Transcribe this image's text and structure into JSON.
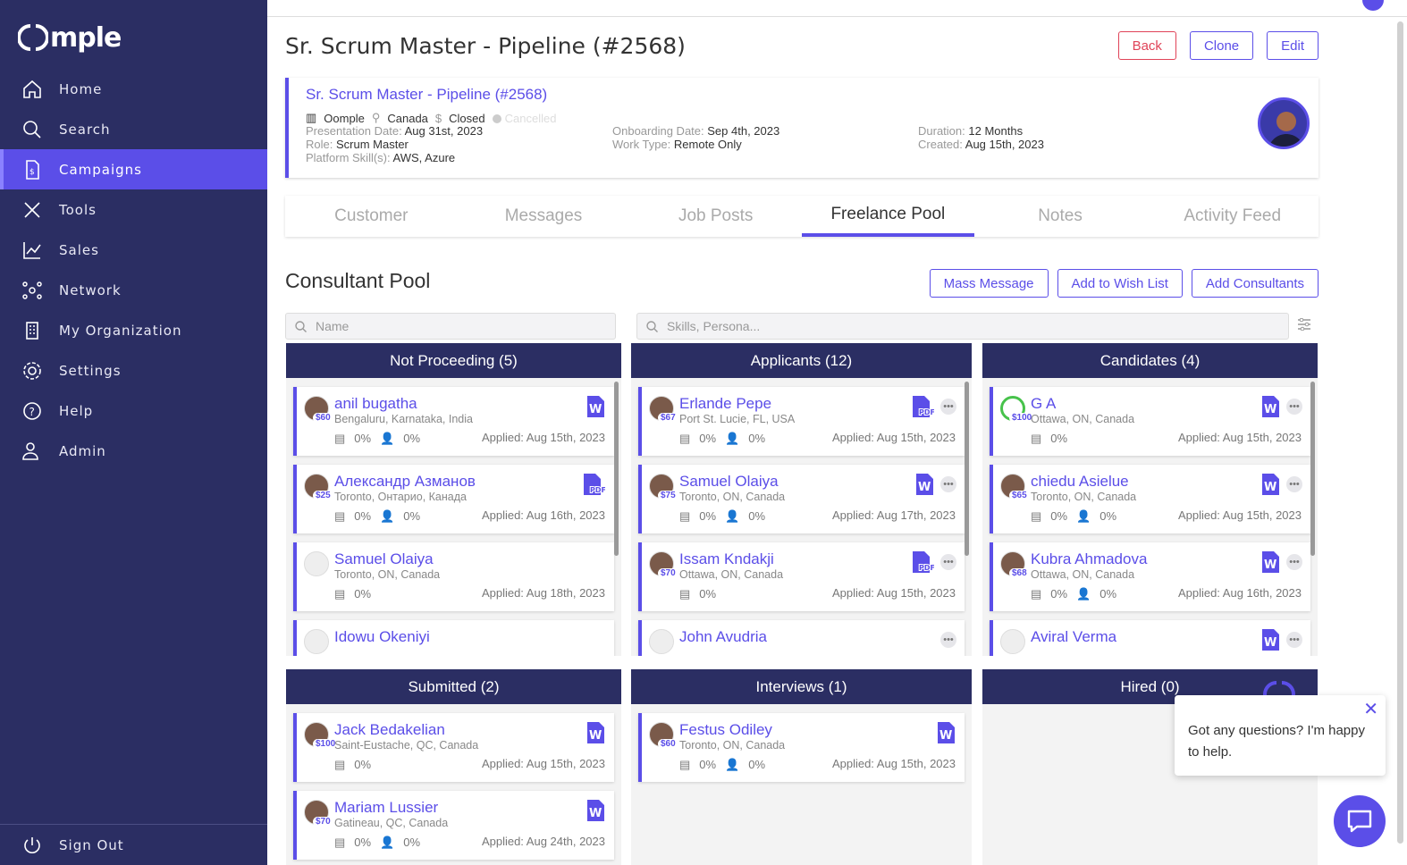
{
  "brand": {
    "logo": "mple"
  },
  "nav": {
    "items": [
      {
        "label": "Home",
        "icon": "home-icon"
      },
      {
        "label": "Search",
        "icon": "search-icon"
      },
      {
        "label": "Campaigns",
        "icon": "campaigns-icon"
      },
      {
        "label": "Tools",
        "icon": "tools-icon"
      },
      {
        "label": "Sales",
        "icon": "chart-icon"
      },
      {
        "label": "Network",
        "icon": "network-icon"
      },
      {
        "label": "My Organization",
        "icon": "building-icon"
      },
      {
        "label": "Settings",
        "icon": "gear-icon"
      },
      {
        "label": "Help",
        "icon": "help-icon"
      },
      {
        "label": "Admin",
        "icon": "admin-icon"
      }
    ],
    "signout": "Sign Out"
  },
  "header": {
    "title": "Sr. Scrum Master - Pipeline (#2568)",
    "back": "Back",
    "clone": "Clone",
    "edit": "Edit"
  },
  "campaign": {
    "title": "Sr. Scrum Master - Pipeline (#2568)",
    "company": "Oomple",
    "country": "Canada",
    "status": "Closed",
    "cancelled": "Cancelled",
    "presentation_k": "Presentation Date:",
    "presentation_v": "Aug 31st, 2023",
    "role_k": "Role:",
    "role_v": "Scrum Master",
    "skills_k": "Platform Skill(s):",
    "skills_v": "AWS, Azure",
    "onboarding_k": "Onboarding Date:",
    "onboarding_v": "Sep 4th, 2023",
    "worktype_k": "Work Type:",
    "worktype_v": "Remote Only",
    "duration_k": "Duration:",
    "duration_v": "12 Months",
    "created_k": "Created:",
    "created_v": "Aug 15th, 2023"
  },
  "tabs": [
    "Customer",
    "Messages",
    "Job Posts",
    "Freelance Pool",
    "Notes",
    "Activity Feed"
  ],
  "pool": {
    "title": "Consultant Pool",
    "mass_message": "Mass Message",
    "wish_list": "Add to Wish List",
    "add_consultants": "Add Consultants",
    "name_placeholder": "Name",
    "skills_placeholder": "Skills, Persona..."
  },
  "columns": [
    {
      "title": "Not Proceeding (5)",
      "cards": [
        {
          "name": "anil bugatha",
          "rate": "$60",
          "loc": "Bengaluru, Karnataka, India",
          "s1": "0%",
          "s2": "0%",
          "applied": "Applied: Aug 15th, 2023",
          "doc": "word"
        },
        {
          "name": "Александр Азманов",
          "rate": "$25",
          "loc": "Toronto, Онтарио, Канада",
          "s1": "0%",
          "s2": "0%",
          "applied": "Applied: Aug 16th, 2023",
          "doc": "pdf"
        },
        {
          "name": "Samuel Olaiya",
          "rate": "",
          "loc": "Toronto, ON, Canada",
          "s1": "0%",
          "s2": "",
          "applied": "Applied: Aug 18th, 2023",
          "doc": ""
        },
        {
          "name": "Idowu Okeniyi",
          "rate": "",
          "loc": "",
          "s1": "",
          "s2": "",
          "applied": "",
          "doc": ""
        }
      ]
    },
    {
      "title": "Applicants (12)",
      "cards": [
        {
          "name": "Erlande Pepe",
          "rate": "$67",
          "loc": "Port St. Lucie, FL, USA",
          "s1": "0%",
          "s2": "0%",
          "applied": "Applied: Aug 15th, 2023",
          "doc": "pdf"
        },
        {
          "name": "Samuel Olaiya",
          "rate": "$75",
          "loc": "Toronto, ON, Canada",
          "s1": "0%",
          "s2": "0%",
          "applied": "Applied: Aug 17th, 2023",
          "doc": "word"
        },
        {
          "name": "Issam Kndakji",
          "rate": "$70",
          "loc": "Ottawa, ON, Canada",
          "s1": "0%",
          "s2": "",
          "applied": "Applied: Aug 15th, 2023",
          "doc": "pdf"
        },
        {
          "name": "John Avudria",
          "rate": "",
          "loc": "",
          "s1": "",
          "s2": "",
          "applied": "",
          "doc": ""
        }
      ]
    },
    {
      "title": "Candidates (4)",
      "cards": [
        {
          "name": "G A",
          "rate": "$100",
          "loc": "Ottawa, ON, Canada",
          "s1": "0%",
          "s2": "",
          "applied": "Applied: Aug 15th, 2023",
          "doc": "word"
        },
        {
          "name": "chiedu Asielue",
          "rate": "$65",
          "loc": "Toronto, ON, Canada",
          "s1": "0%",
          "s2": "0%",
          "applied": "Applied: Aug 15th, 2023",
          "doc": "word"
        },
        {
          "name": "Kubra Ahmadova",
          "rate": "$68",
          "loc": "Ottawa, ON, Canada",
          "s1": "0%",
          "s2": "0%",
          "applied": "Applied: Aug 16th, 2023",
          "doc": "word"
        },
        {
          "name": "Aviral Verma",
          "rate": "",
          "loc": "",
          "s1": "",
          "s2": "",
          "applied": "",
          "doc": "word"
        }
      ]
    },
    {
      "title": "Submitted (2)",
      "cards": [
        {
          "name": "Jack Bedakelian",
          "rate": "$100",
          "loc": "Saint-Eustache, QC, Canada",
          "s1": "0%",
          "s2": "",
          "applied": "Applied: Aug 15th, 2023",
          "doc": "word"
        },
        {
          "name": "Mariam Lussier",
          "rate": "$70",
          "loc": "Gatineau, QC, Canada",
          "s1": "0%",
          "s2": "0%",
          "applied": "Applied: Aug 24th, 2023",
          "doc": "word"
        }
      ]
    },
    {
      "title": "Interviews (1)",
      "cards": [
        {
          "name": "Festus Odiley",
          "rate": "$60",
          "loc": "Toronto, ON, Canada",
          "s1": "0%",
          "s2": "0%",
          "applied": "Applied: Aug 15th, 2023",
          "doc": "word"
        }
      ]
    },
    {
      "title": "Hired (0)",
      "cards": []
    }
  ],
  "chat": {
    "message": "Got any questions? I'm happy to help."
  },
  "colors": {
    "sidebar": "#2b2e63",
    "accent": "#5b4ee8",
    "danger": "#e04358"
  }
}
